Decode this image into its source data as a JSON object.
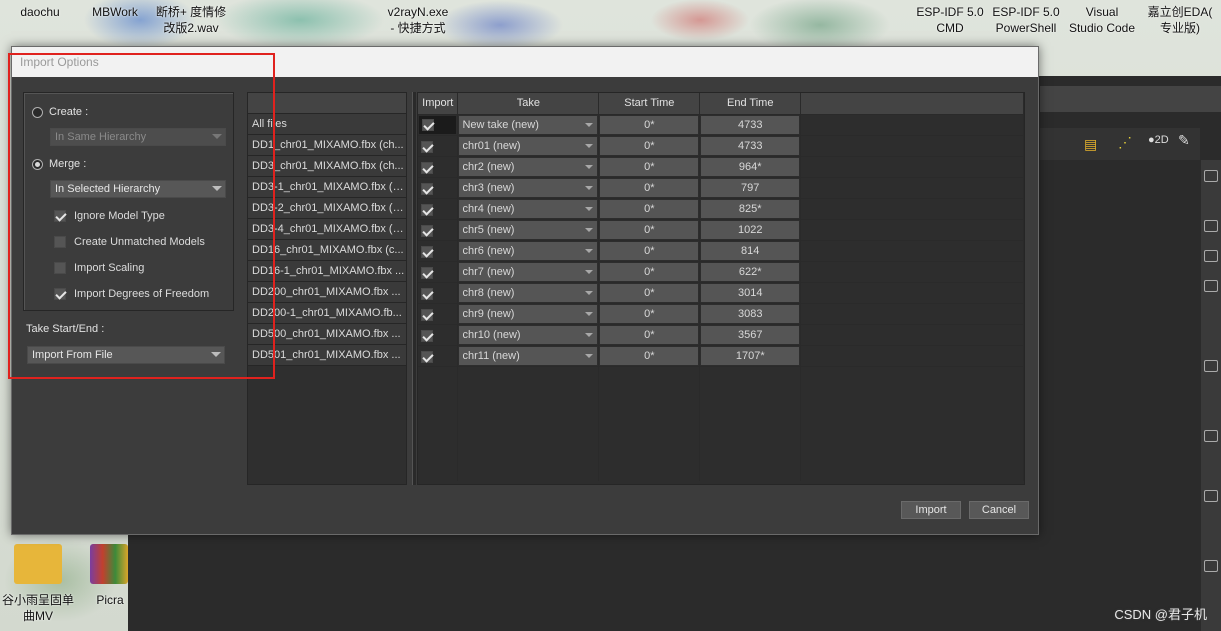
{
  "desktop": {
    "top_icons": [
      "daochu",
      "MBWork",
      "断桥+ 度情修\n改版2.wav",
      "v2rayN.exe\n- 快捷方式",
      "ESP-IDF 5.0\nCMD",
      "ESP-IDF 5.0\nPowerShell",
      "Visual\nStudio Code",
      "嘉立创EDA(\n专业版)"
    ],
    "bottom_icons": [
      "谷小雨呈固单\n曲MV",
      "Picra"
    ],
    "watermark": "CSDN @君子机"
  },
  "dialog": {
    "title": "Import Options",
    "create_label": "Create :",
    "create_combo": "In Same Hierarchy",
    "merge_label": "Merge :",
    "merge_combo": "In Selected Hierarchy",
    "options": [
      {
        "label": "Ignore Model Type",
        "checked": true
      },
      {
        "label": "Create Unmatched Models",
        "checked": false
      },
      {
        "label": "Import Scaling",
        "checked": false
      },
      {
        "label": "Import Degrees of Freedom",
        "checked": true
      }
    ],
    "take_label": "Take Start/End :",
    "take_combo": "Import From File",
    "files": [
      "All files",
      "DD1_chr01_MIXAMO.fbx (ch...",
      "DD3_chr01_MIXAMO.fbx (ch...",
      "DD3-1_chr01_MIXAMO.fbx (c...",
      "DD3-2_chr01_MIXAMO.fbx (c...",
      "DD3-4_chr01_MIXAMO.fbx (c...",
      "DD16_chr01_MIXAMO.fbx (c...",
      "DD16-1_chr01_MIXAMO.fbx ...",
      "DD200_chr01_MIXAMO.fbx ...",
      "DD200-1_chr01_MIXAMO.fb...",
      "DD500_chr01_MIXAMO.fbx ...",
      "DD501_chr01_MIXAMO.fbx ..."
    ],
    "columns": [
      "Import",
      "Take",
      "Start Time",
      "End Time"
    ],
    "rows": [
      {
        "import": true,
        "take": "New take (new)",
        "start": "0*",
        "end": "4733"
      },
      {
        "import": true,
        "take": "chr01 (new)",
        "start": "0*",
        "end": "4733"
      },
      {
        "import": true,
        "take": "chr2 (new)",
        "start": "0*",
        "end": "964*"
      },
      {
        "import": true,
        "take": "chr3 (new)",
        "start": "0*",
        "end": "797"
      },
      {
        "import": true,
        "take": "chr4 (new)",
        "start": "0*",
        "end": "825*"
      },
      {
        "import": true,
        "take": "chr5 (new)",
        "start": "0*",
        "end": "1022"
      },
      {
        "import": true,
        "take": "chr6 (new)",
        "start": "0*",
        "end": "814"
      },
      {
        "import": true,
        "take": "chr7 (new)",
        "start": "0*",
        "end": "622*"
      },
      {
        "import": true,
        "take": "chr8 (new)",
        "start": "0*",
        "end": "3014"
      },
      {
        "import": true,
        "take": "chr9 (new)",
        "start": "0*",
        "end": "3083"
      },
      {
        "import": true,
        "take": "chr10 (new)",
        "start": "0*",
        "end": "3567"
      },
      {
        "import": true,
        "take": "chr11 (new)",
        "start": "0*",
        "end": "1707*"
      }
    ],
    "import_button": "Import",
    "cancel_button": "Cancel"
  },
  "colors": {
    "annotation": "#e0221e",
    "panel": "#3c3c3c"
  }
}
